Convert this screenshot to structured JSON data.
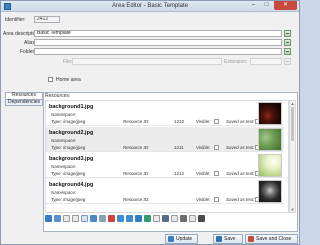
{
  "window": {
    "title": "Area Editor - Basic Template",
    "minimize": "–",
    "maximize": "□",
    "close": "✕"
  },
  "form": {
    "identifier_label": "Identifier:",
    "identifier_value": "2412",
    "description_label": "Area description:",
    "description_value": "Basic Template",
    "alias_label": "Alias:",
    "alias_value": "",
    "folder_label": "Folder:",
    "folder_value": "",
    "file_label": "File:",
    "file_value": "",
    "extension_label": "Extension:",
    "extension_value": "",
    "home_area_label": "Home area",
    "home_area_checked": false
  },
  "tabs": [
    {
      "label": "Resources",
      "active": true
    },
    {
      "label": "Dependencies",
      "active": false
    }
  ],
  "resources_panel": {
    "label": "Resources:",
    "items": [
      {
        "name": "background1.jpg",
        "namespace_label": "Namespace:",
        "namespace": "",
        "type_label": "Type:",
        "type": "image/jpeg",
        "id_label": "Resource ID:",
        "id": "1210",
        "visible_label": "Visible:",
        "saved_label": "Saved as text:",
        "thumb_icon": "dark-red-texture-image",
        "selected": false
      },
      {
        "name": "background2.jpg",
        "namespace_label": "Namespace:",
        "namespace": "",
        "type_label": "Type:",
        "type": "image/jpeg",
        "id_label": "Resource ID:",
        "id": "1211",
        "visible_label": "Visible:",
        "saved_label": "Saved as text:",
        "thumb_icon": "green-texture-image",
        "selected": true
      },
      {
        "name": "background3.jpg",
        "namespace_label": "Namespace:",
        "namespace": "",
        "type_label": "Type:",
        "type": "image/jpeg",
        "id_label": "Resource ID:",
        "id": "1212",
        "visible_label": "Visible:",
        "saved_label": "Saved as text:",
        "thumb_icon": "light-green-glow-image",
        "selected": false
      },
      {
        "name": "background4.jpg",
        "namespace_label": "Namespace:",
        "namespace": "",
        "type_label": "Type:",
        "type": "image/jpeg",
        "id_label": "Resource ID:",
        "id": "",
        "visible_label": "Visible:",
        "saved_label": "Saved as text:",
        "thumb_icon": "dark-grey-texture-image",
        "selected": false
      }
    ]
  },
  "toolbar": {
    "icons": [
      "add-image-icon",
      "add-file-icon",
      "new-file-icon",
      "edit-file-icon",
      "copy-icon",
      "properties-icon",
      "cut-icon",
      "delete-icon",
      "import-icon",
      "export-icon",
      "move-up-icon",
      "move-down-icon",
      "refresh-icon",
      "duplicate-icon",
      "folder-icon",
      "image-view-icon",
      "open-icon",
      "save-resource-icon"
    ]
  },
  "buttons": {
    "update": "Update",
    "save": "Save",
    "save_close": "Save and Close"
  },
  "colors": {
    "accent": "#3f7fc5",
    "close_button": "#c94a3b",
    "selected_row": "#ececec"
  }
}
